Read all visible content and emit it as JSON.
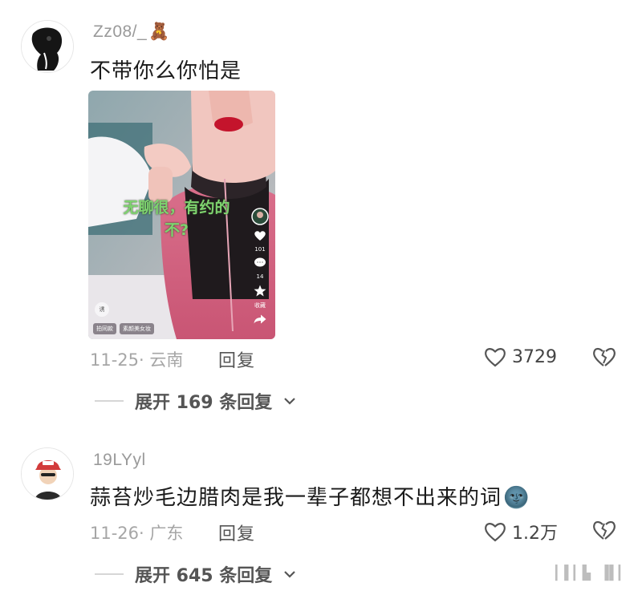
{
  "comments": [
    {
      "username": "Zz08/_",
      "username_emoji": "🧸",
      "content": "不带你么你怕是",
      "image": {
        "caption_line1": "无聊很，有约的",
        "caption_line2": "不?",
        "side_counts": {
          "likes": "101",
          "comments": "14",
          "favorites": "收藏"
        },
        "chip1": "拍同款",
        "chip2": "素颜美女妆",
        "logo": "诱"
      },
      "date_location": "11-25· 云南",
      "reply_label": "回复",
      "likes": "3729",
      "expand_label": "展开 169 条回复"
    },
    {
      "username": "19LYyl",
      "content": "蒜苔炒毛边腊肉是我一辈子都想不出来的词",
      "content_emoji": "🌚",
      "date_location": "11-26· 广东",
      "reply_label": "回复",
      "likes": "1.2万",
      "expand_label": "展开 645 条回复"
    }
  ],
  "watermark": "▎▌▎▙ ▐▌▎"
}
